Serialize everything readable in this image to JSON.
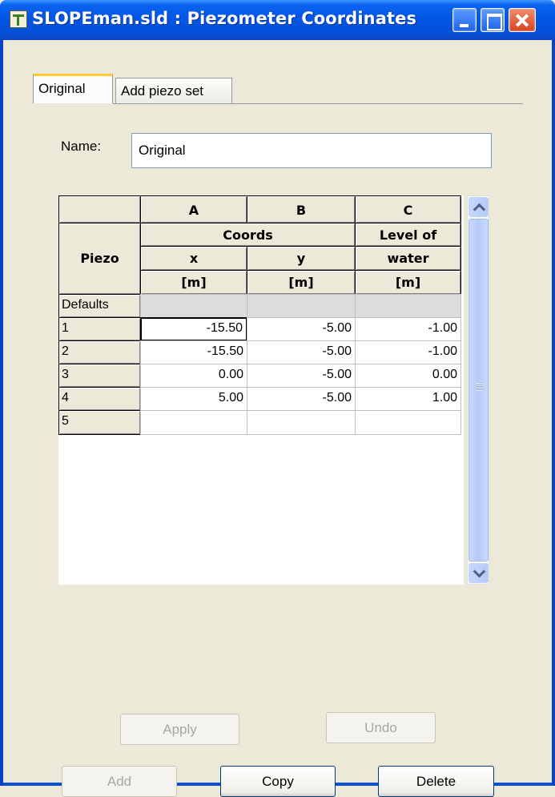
{
  "window": {
    "title": "SLOPEman.sld : Piezometer Coordinates"
  },
  "tabs": [
    {
      "label": "Original",
      "selected": true
    },
    {
      "label": "Add piezo set",
      "selected": false
    }
  ],
  "name_field": {
    "label": "Name:",
    "value": "Original"
  },
  "table": {
    "column_letters": [
      "A",
      "B",
      "C"
    ],
    "piezo_header": "Piezo",
    "coords_header": "Coords",
    "level_header_1": "Level of",
    "level_header_2": "water",
    "x_header": "x",
    "y_header": "y",
    "units": [
      "[m]",
      "[m]",
      "[m]"
    ],
    "defaults_label": "Defaults",
    "rows": [
      {
        "label": "1",
        "x": "-15.50",
        "y": "-5.00",
        "level": "-1.00"
      },
      {
        "label": "2",
        "x": "-15.50",
        "y": "-5.00",
        "level": "-1.00"
      },
      {
        "label": "3",
        "x": "0.00",
        "y": "-5.00",
        "level": "0.00"
      },
      {
        "label": "4",
        "x": "5.00",
        "y": "-5.00",
        "level": "1.00"
      },
      {
        "label": "5",
        "x": "",
        "y": "",
        "level": ""
      }
    ]
  },
  "buttons": {
    "apply": "Apply",
    "undo": "Undo",
    "add": "Add",
    "copy": "Copy",
    "delete": "Delete"
  },
  "colors": {
    "titlebar": "#0356e6",
    "face": "#ece9d8",
    "tab_highlight": "#ffc83c"
  }
}
